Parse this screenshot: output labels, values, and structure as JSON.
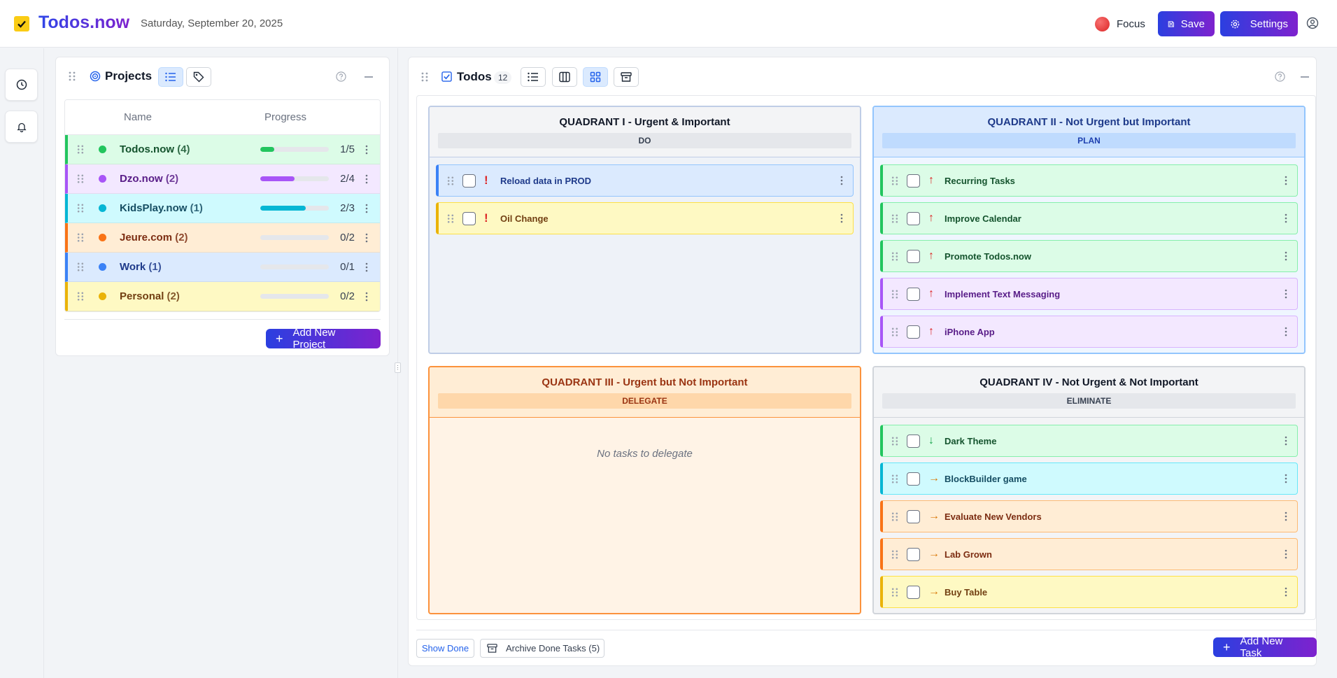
{
  "header": {
    "app_title": "Todos.now",
    "date": "Saturday, September 20, 2025",
    "focus_label": "Focus",
    "save_label": "Save",
    "settings_label": "Settings"
  },
  "projects": {
    "title": "Projects",
    "col_name": "Name",
    "col_progress": "Progress",
    "add_label": "Add New Project",
    "rows": [
      {
        "name": "Todos.now",
        "count": "(4)",
        "progress_label": "1/5",
        "progress": 0.2,
        "color": "#22c55e",
        "bg": "#dcfce7",
        "text": "#14532d"
      },
      {
        "name": "Dzo.now",
        "count": "(2)",
        "progress_label": "2/4",
        "progress": 0.5,
        "color": "#a855f7",
        "bg": "#f3e8ff",
        "text": "#581c87"
      },
      {
        "name": "KidsPlay.now",
        "count": "(1)",
        "progress_label": "2/3",
        "progress": 0.667,
        "color": "#06b6d4",
        "bg": "#cffafe",
        "text": "#164e63"
      },
      {
        "name": "Jeure.com",
        "count": "(2)",
        "progress_label": "0/2",
        "progress": 0,
        "color": "#f97316",
        "bg": "#ffedd5",
        "text": "#7c2d12"
      },
      {
        "name": "Work",
        "count": "(1)",
        "progress_label": "0/1",
        "progress": 0,
        "color": "#3b82f6",
        "bg": "#dbeafe",
        "text": "#1e3a8a"
      },
      {
        "name": "Personal",
        "count": "(2)",
        "progress_label": "0/2",
        "progress": 0,
        "color": "#eab308",
        "bg": "#fef9c3",
        "text": "#713f12"
      }
    ]
  },
  "todos": {
    "title": "Todos",
    "count": "12",
    "show_done": "Show Done",
    "archive_label": "Archive Done Tasks (5)",
    "add_label": "Add New Task",
    "q1": {
      "title": "QUADRANT I - Urgent & Important",
      "tag": "DO",
      "tasks": [
        {
          "name": "Reload data in PROD",
          "priority": "!"
        },
        {
          "name": "Oil Change",
          "priority": "!"
        }
      ]
    },
    "q2": {
      "title": "QUADRANT II - Not Urgent but Important",
      "tag": "PLAN",
      "tasks": [
        {
          "name": "Recurring Tasks",
          "priority": "↑"
        },
        {
          "name": "Improve Calendar",
          "priority": "↑"
        },
        {
          "name": "Promote Todos.now",
          "priority": "↑"
        },
        {
          "name": "Implement Text Messaging",
          "priority": "↑"
        },
        {
          "name": "iPhone App",
          "priority": "↑"
        }
      ]
    },
    "q3": {
      "title": "QUADRANT III - Urgent but Not Important",
      "tag": "DELEGATE",
      "empty": "No tasks to delegate"
    },
    "q4": {
      "title": "QUADRANT IV - Not Urgent & Not Important",
      "tag": "ELIMINATE",
      "tasks": [
        {
          "name": "Dark Theme",
          "priority": "↓"
        },
        {
          "name": "BlockBuilder game",
          "priority": "→"
        },
        {
          "name": "Evaluate New Vendors",
          "priority": "→"
        },
        {
          "name": "Lab Grown",
          "priority": "→"
        },
        {
          "name": "Buy Table",
          "priority": "→"
        }
      ]
    }
  }
}
